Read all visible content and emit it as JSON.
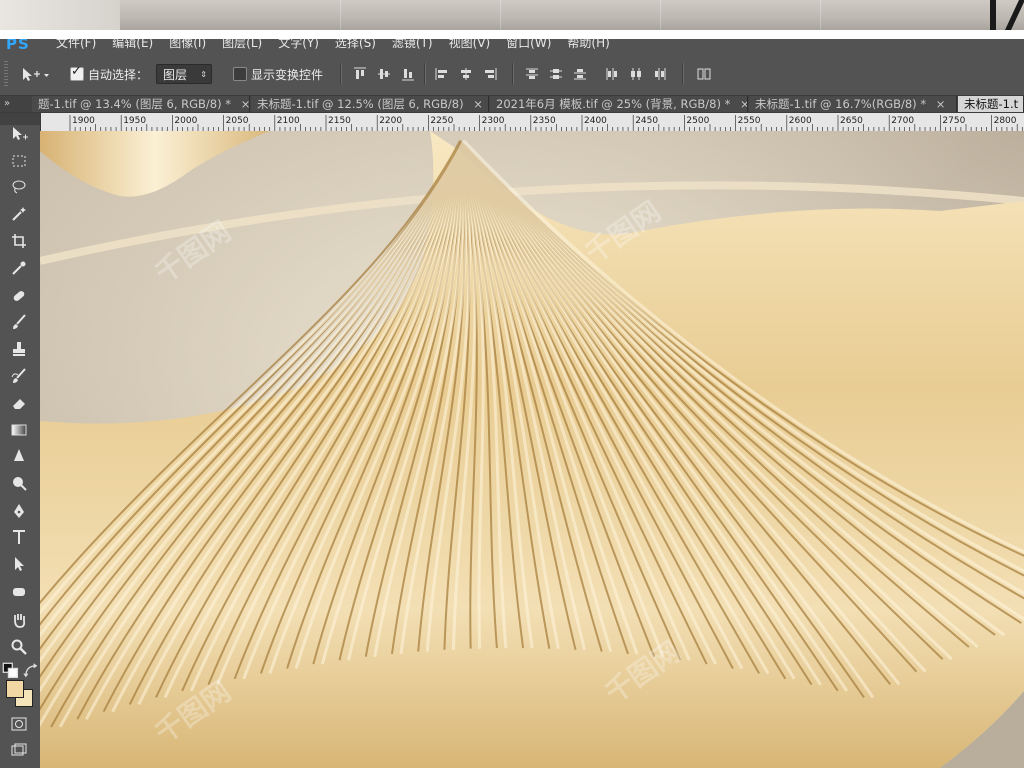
{
  "app": {
    "logo": "PS"
  },
  "menu": [
    "文件(F)",
    "编辑(E)",
    "图像(I)",
    "图层(L)",
    "文字(Y)",
    "选择(S)",
    "滤镜(T)",
    "视图(V)",
    "窗口(W)",
    "帮助(H)"
  ],
  "options": {
    "auto_select_checked": true,
    "auto_select_label": "自动选择：",
    "auto_select_target": "图层",
    "show_transform_checked": false,
    "show_transform_label": "显示变换控件"
  },
  "tabs": [
    {
      "label": "题-1.tif @ 13.4% (图层 6, RGB/8) *",
      "close": "×",
      "active": false
    },
    {
      "label": "未标题-1.tif @ 12.5% (图层 6, RGB/8)",
      "close": "×",
      "active": false
    },
    {
      "label": "2021年6月 模板.tif @ 25% (背景, RGB/8) *",
      "close": "×",
      "active": false
    },
    {
      "label": "未标题-1.tif @ 16.7%(RGB/8) *",
      "close": "×",
      "active": false
    },
    {
      "label": "未标题-1.t",
      "close": "",
      "active": true
    }
  ],
  "ruler_labels": [
    "1900",
    "1950",
    "2000",
    "2050",
    "2100",
    "2150",
    "2200",
    "2250",
    "2300",
    "2350",
    "2400",
    "2450",
    "2500",
    "2550",
    "2600",
    "2650",
    "2700",
    "2750",
    "2800"
  ],
  "tools": [
    "move-tool-icon",
    "marquee-icon",
    "lasso-icon",
    "magic-wand-icon",
    "crop-icon",
    "eyedropper-icon",
    "healing-brush-icon",
    "brush-icon",
    "clone-stamp-icon",
    "history-brush-icon",
    "eraser-icon",
    "gradient-icon",
    "blur-icon",
    "dodge-icon",
    "pen-icon",
    "type-icon",
    "path-selection-icon",
    "shape-icon",
    "hand-icon",
    "zoom-icon"
  ],
  "colors": {
    "foreground": "#f0d7a3",
    "background": "#f5e4b9",
    "accent": "#31a8ff"
  }
}
